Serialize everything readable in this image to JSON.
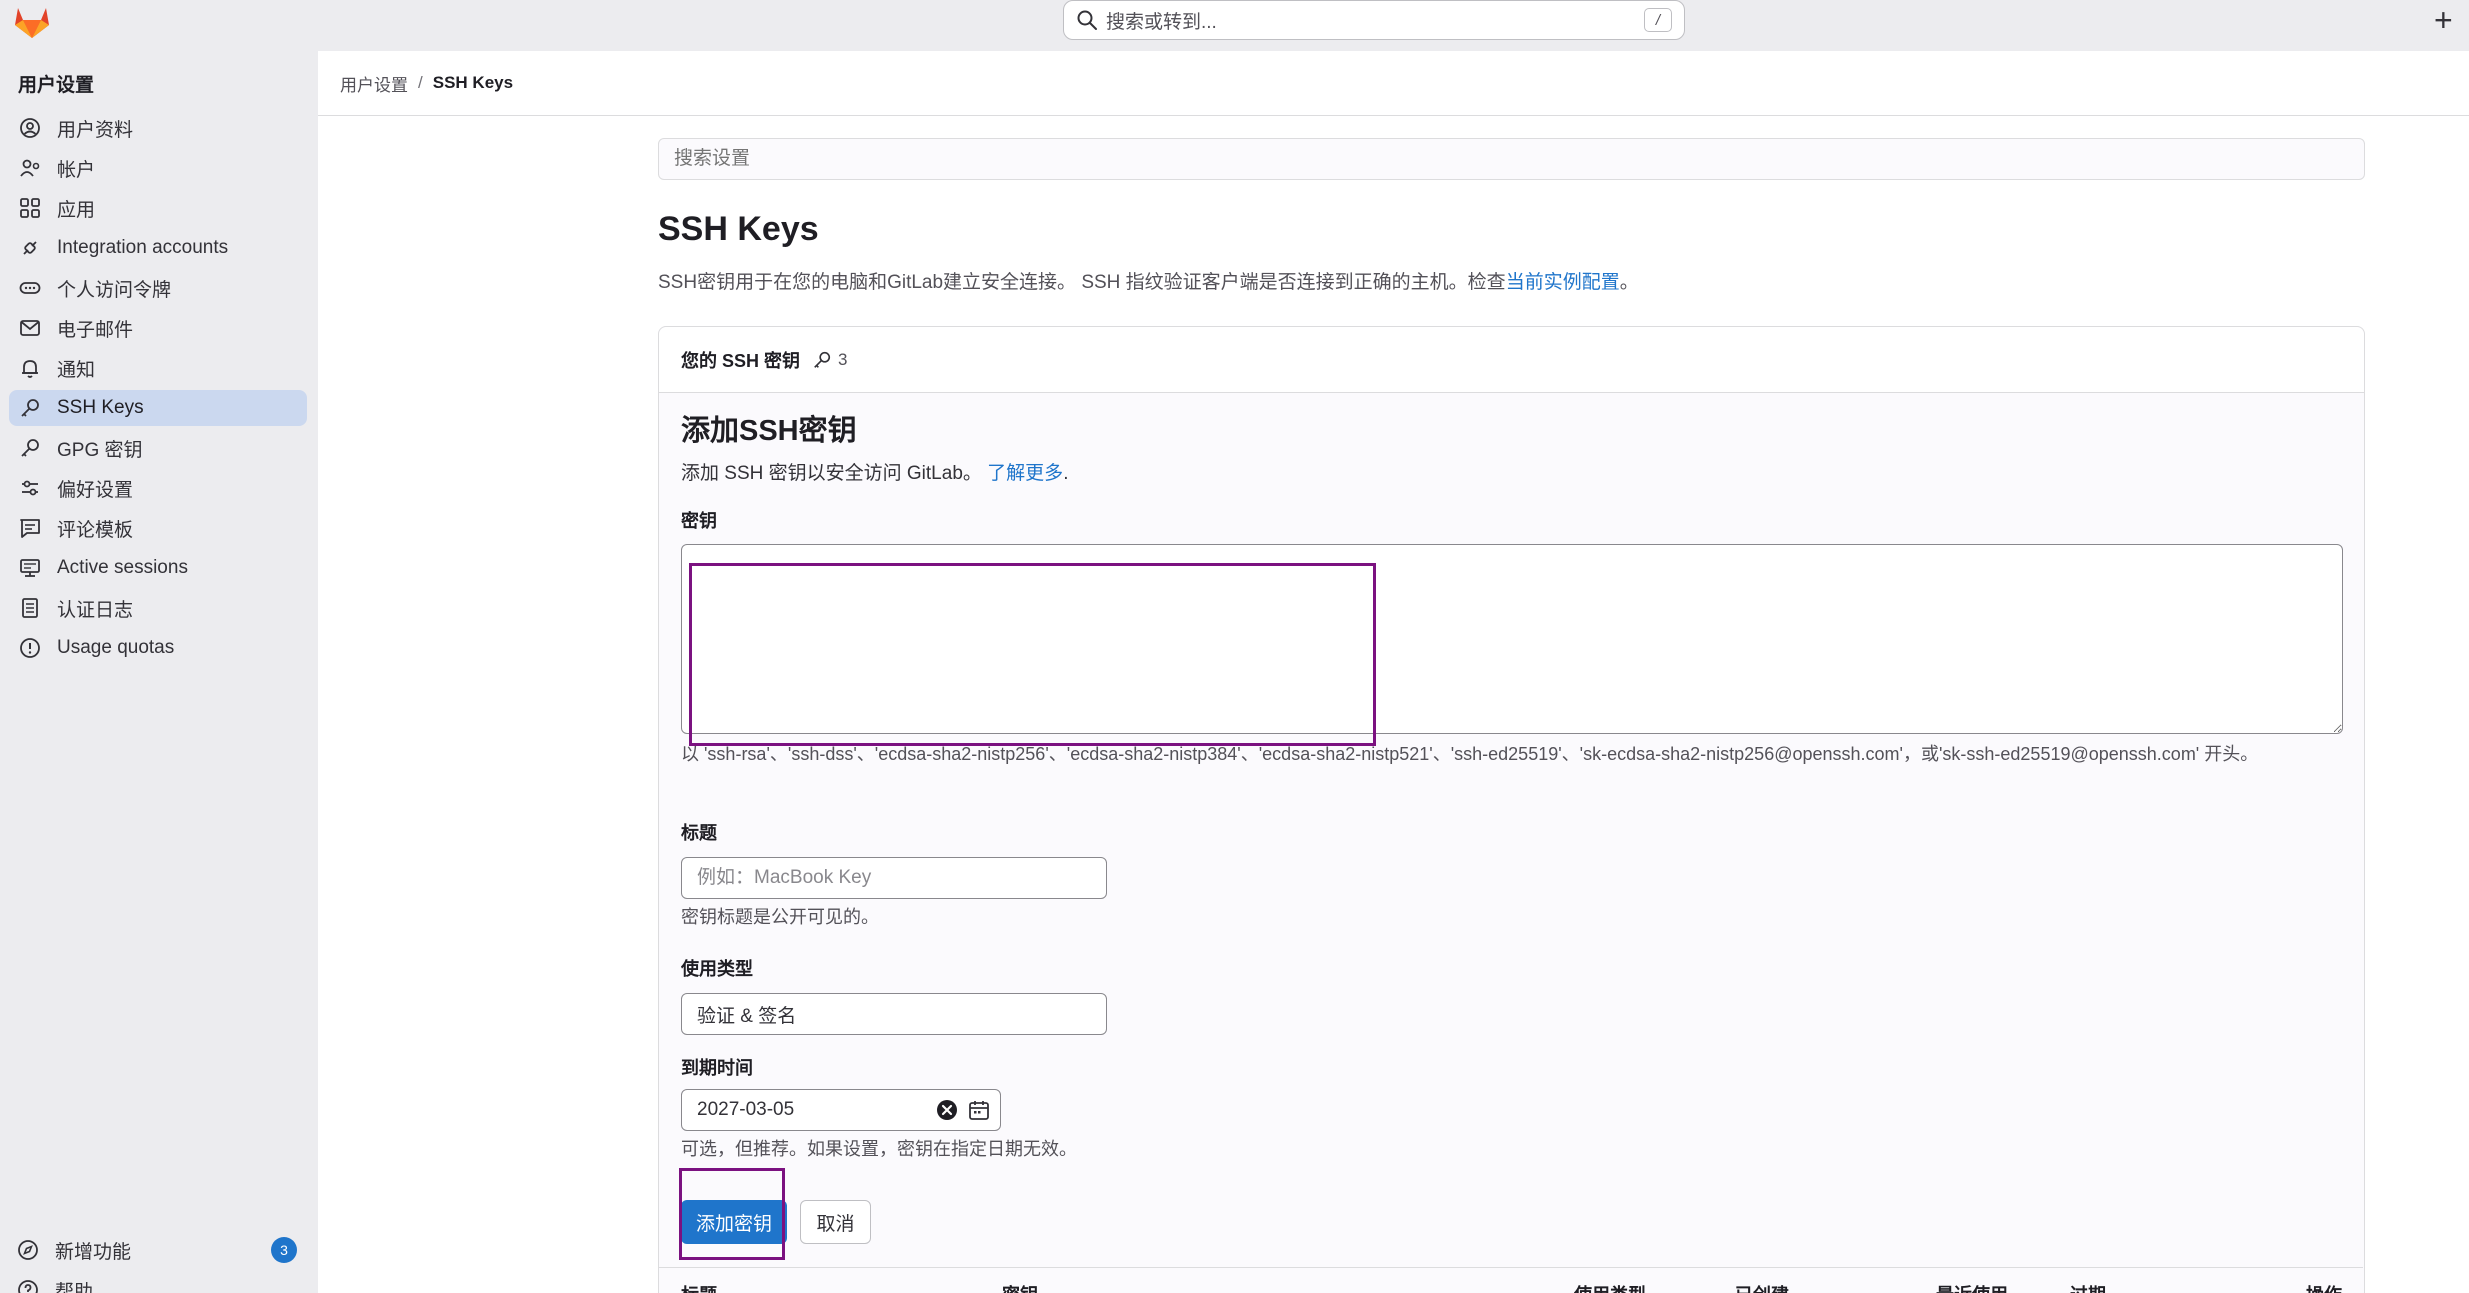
{
  "topbar": {
    "search_placeholder": "搜索或转到...",
    "search_shortcut": "/",
    "new_button": "+"
  },
  "sidebar": {
    "title": "用户设置",
    "items": [
      {
        "label": "用户资料",
        "icon": "profile-icon"
      },
      {
        "label": "帐户",
        "icon": "account-icon"
      },
      {
        "label": "应用",
        "icon": "applications-icon"
      },
      {
        "label": "Integration accounts",
        "icon": "integrations-icon"
      },
      {
        "label": "个人访问令牌",
        "icon": "token-icon"
      },
      {
        "label": "电子邮件",
        "icon": "mail-icon"
      },
      {
        "label": "通知",
        "icon": "bell-icon"
      },
      {
        "label": "SSH Keys",
        "icon": "key-icon",
        "active": true
      },
      {
        "label": "GPG 密钥",
        "icon": "gpg-key-icon"
      },
      {
        "label": "偏好设置",
        "icon": "preferences-icon"
      },
      {
        "label": "评论模板",
        "icon": "comment-template-icon"
      },
      {
        "label": "Active sessions",
        "icon": "monitor-icon"
      },
      {
        "label": "认证日志",
        "icon": "log-icon"
      },
      {
        "label": "Usage quotas",
        "icon": "quota-icon"
      }
    ],
    "bottom": {
      "whats_new": "新增功能",
      "whats_new_count": "3",
      "help": "帮助"
    }
  },
  "breadcrumb": {
    "parent": "用户设置",
    "separator": "/",
    "current": "SSH Keys"
  },
  "main": {
    "settings_search_placeholder": "搜索设置",
    "title": "SSH Keys",
    "description": "SSH密钥用于在您的电脑和GitLab建立安全连接。 SSH 指纹验证客户端是否连接到正确的主机。检查",
    "description_link": "当前实例配置",
    "description_end": "。",
    "card": {
      "header": "您的 SSH 密钥",
      "key_count": "3",
      "form_title": "添加SSH密钥",
      "form_desc": "添加 SSH 密钥以安全访问 GitLab。",
      "learn_more": "了解更多",
      "learn_more_end": ".",
      "key_label": "密钥",
      "key_value": "",
      "key_help": "以 'ssh-rsa'、'ssh-dss'、'ecdsa-sha2-nistp256'、'ecdsa-sha2-nistp384'、'ecdsa-sha2-nistp521'、'ssh-ed25519'、'sk-ecdsa-sha2-nistp256@openssh.com'，或'sk-ssh-ed25519@openssh.com' 开头。",
      "title_label": "标题",
      "title_placeholder": "例如：MacBook Key",
      "title_help": "密钥标题是公开可见的。",
      "usage_label": "使用类型",
      "usage_value": "验证 & 签名",
      "expires_label": "到期时间",
      "expires_value": "2027-03-05",
      "expires_help": "可选，但推荐。如果设置，密钥在指定日期无效。",
      "add_button": "添加密钥",
      "cancel_button": "取消",
      "table_headers": [
        "标题",
        "密钥",
        "使用类型",
        "已创建",
        "最近使用",
        "过期",
        "操作"
      ]
    }
  },
  "colors": {
    "accent": "#1f75cb",
    "sidebar_bg": "#ececef",
    "active_item_bg": "#cbd8ef",
    "highlight": "#7b1180"
  }
}
